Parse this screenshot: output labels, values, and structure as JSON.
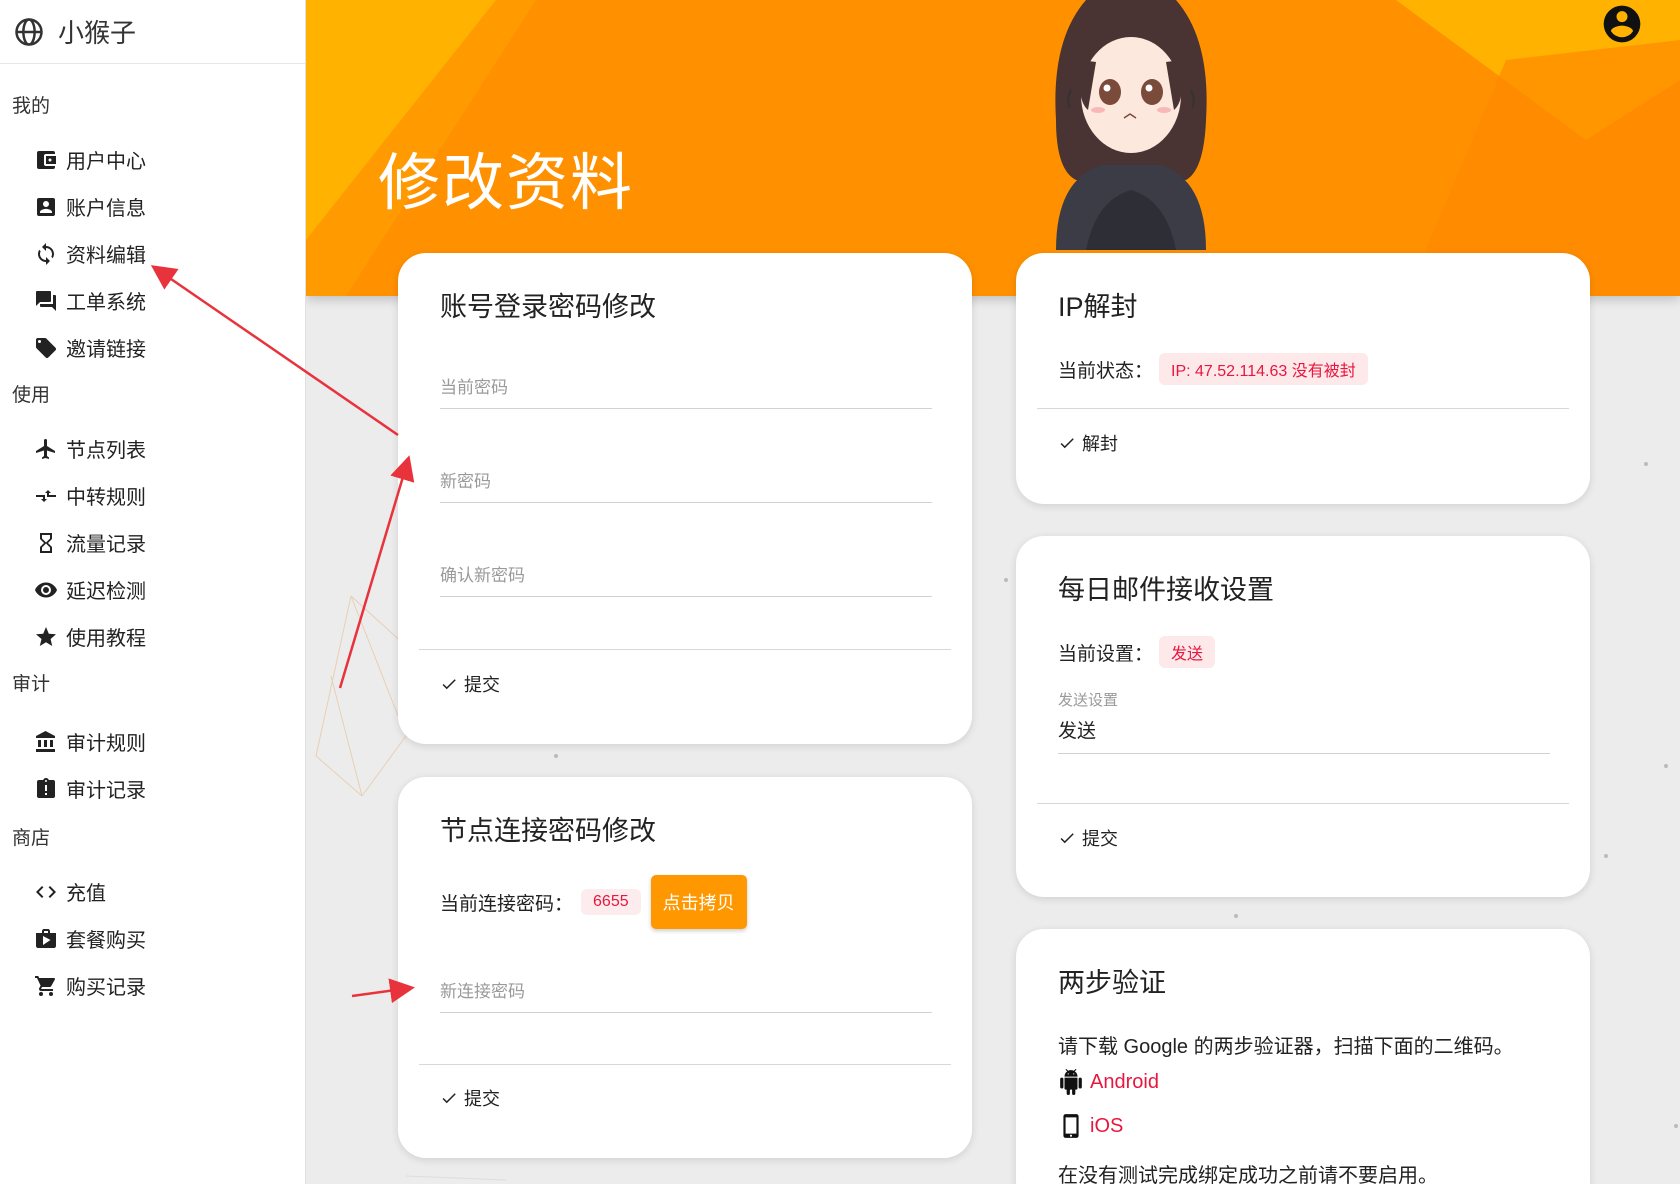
{
  "brand": {
    "name": "小猴子",
    "icon": "globe-icon"
  },
  "sidebar": {
    "sections": [
      {
        "label": "我的",
        "items": [
          {
            "label": "用户中心",
            "icon": "wallet-icon"
          },
          {
            "label": "账户信息",
            "icon": "account-box-icon"
          },
          {
            "label": "资料编辑",
            "icon": "sync-icon"
          },
          {
            "label": "工单系统",
            "icon": "forum-icon"
          },
          {
            "label": "邀请链接",
            "icon": "tag-icon"
          }
        ]
      },
      {
        "label": "使用",
        "items": [
          {
            "label": "节点列表",
            "icon": "airplane-icon"
          },
          {
            "label": "中转规则",
            "icon": "swap-arrows-icon"
          },
          {
            "label": "流量记录",
            "icon": "hourglass-icon"
          },
          {
            "label": "延迟检测",
            "icon": "eye-icon"
          },
          {
            "label": "使用教程",
            "icon": "star-icon"
          }
        ]
      },
      {
        "label": "审计",
        "items": [
          {
            "label": "审计规则",
            "icon": "bank-icon"
          },
          {
            "label": "审计记录",
            "icon": "clipboard-alert-icon"
          }
        ]
      },
      {
        "label": "商店",
        "items": [
          {
            "label": "充值",
            "icon": "code-icon"
          },
          {
            "label": "套餐购买",
            "icon": "shop-bag-icon"
          },
          {
            "label": "购买记录",
            "icon": "cart-icon"
          }
        ]
      }
    ]
  },
  "header": {
    "title": "修改资料",
    "accent": "#ff9100",
    "accent_light": "#ffb300"
  },
  "login_password": {
    "title": "账号登录密码修改",
    "current_placeholder": "当前密码",
    "new_placeholder": "新密码",
    "confirm_placeholder": "确认新密码",
    "submit": "提交"
  },
  "node_password": {
    "title": "节点连接密码修改",
    "current_label": "当前连接密码：",
    "current_value": "6655",
    "copy_button": "点击拷贝",
    "new_placeholder": "新连接密码",
    "submit": "提交"
  },
  "ip_unblock": {
    "title": "IP解封",
    "status_label": "当前状态：",
    "status_value": "IP: 47.52.114.63 没有被封",
    "action": "解封"
  },
  "mail_settings": {
    "title": "每日邮件接收设置",
    "current_label": "当前设置：",
    "current_value": "发送",
    "select_label": "发送设置",
    "select_value": "发送",
    "submit": "提交"
  },
  "two_factor": {
    "title": "两步验证",
    "desc": "请下载 Google 的两步验证器，扫描下面的二维码。",
    "android": "Android",
    "ios": "iOS",
    "warning": "在没有测试完成绑定成功之前请不要启用。"
  },
  "colors": {
    "danger": "#e8173f",
    "button": "#ff9800"
  }
}
